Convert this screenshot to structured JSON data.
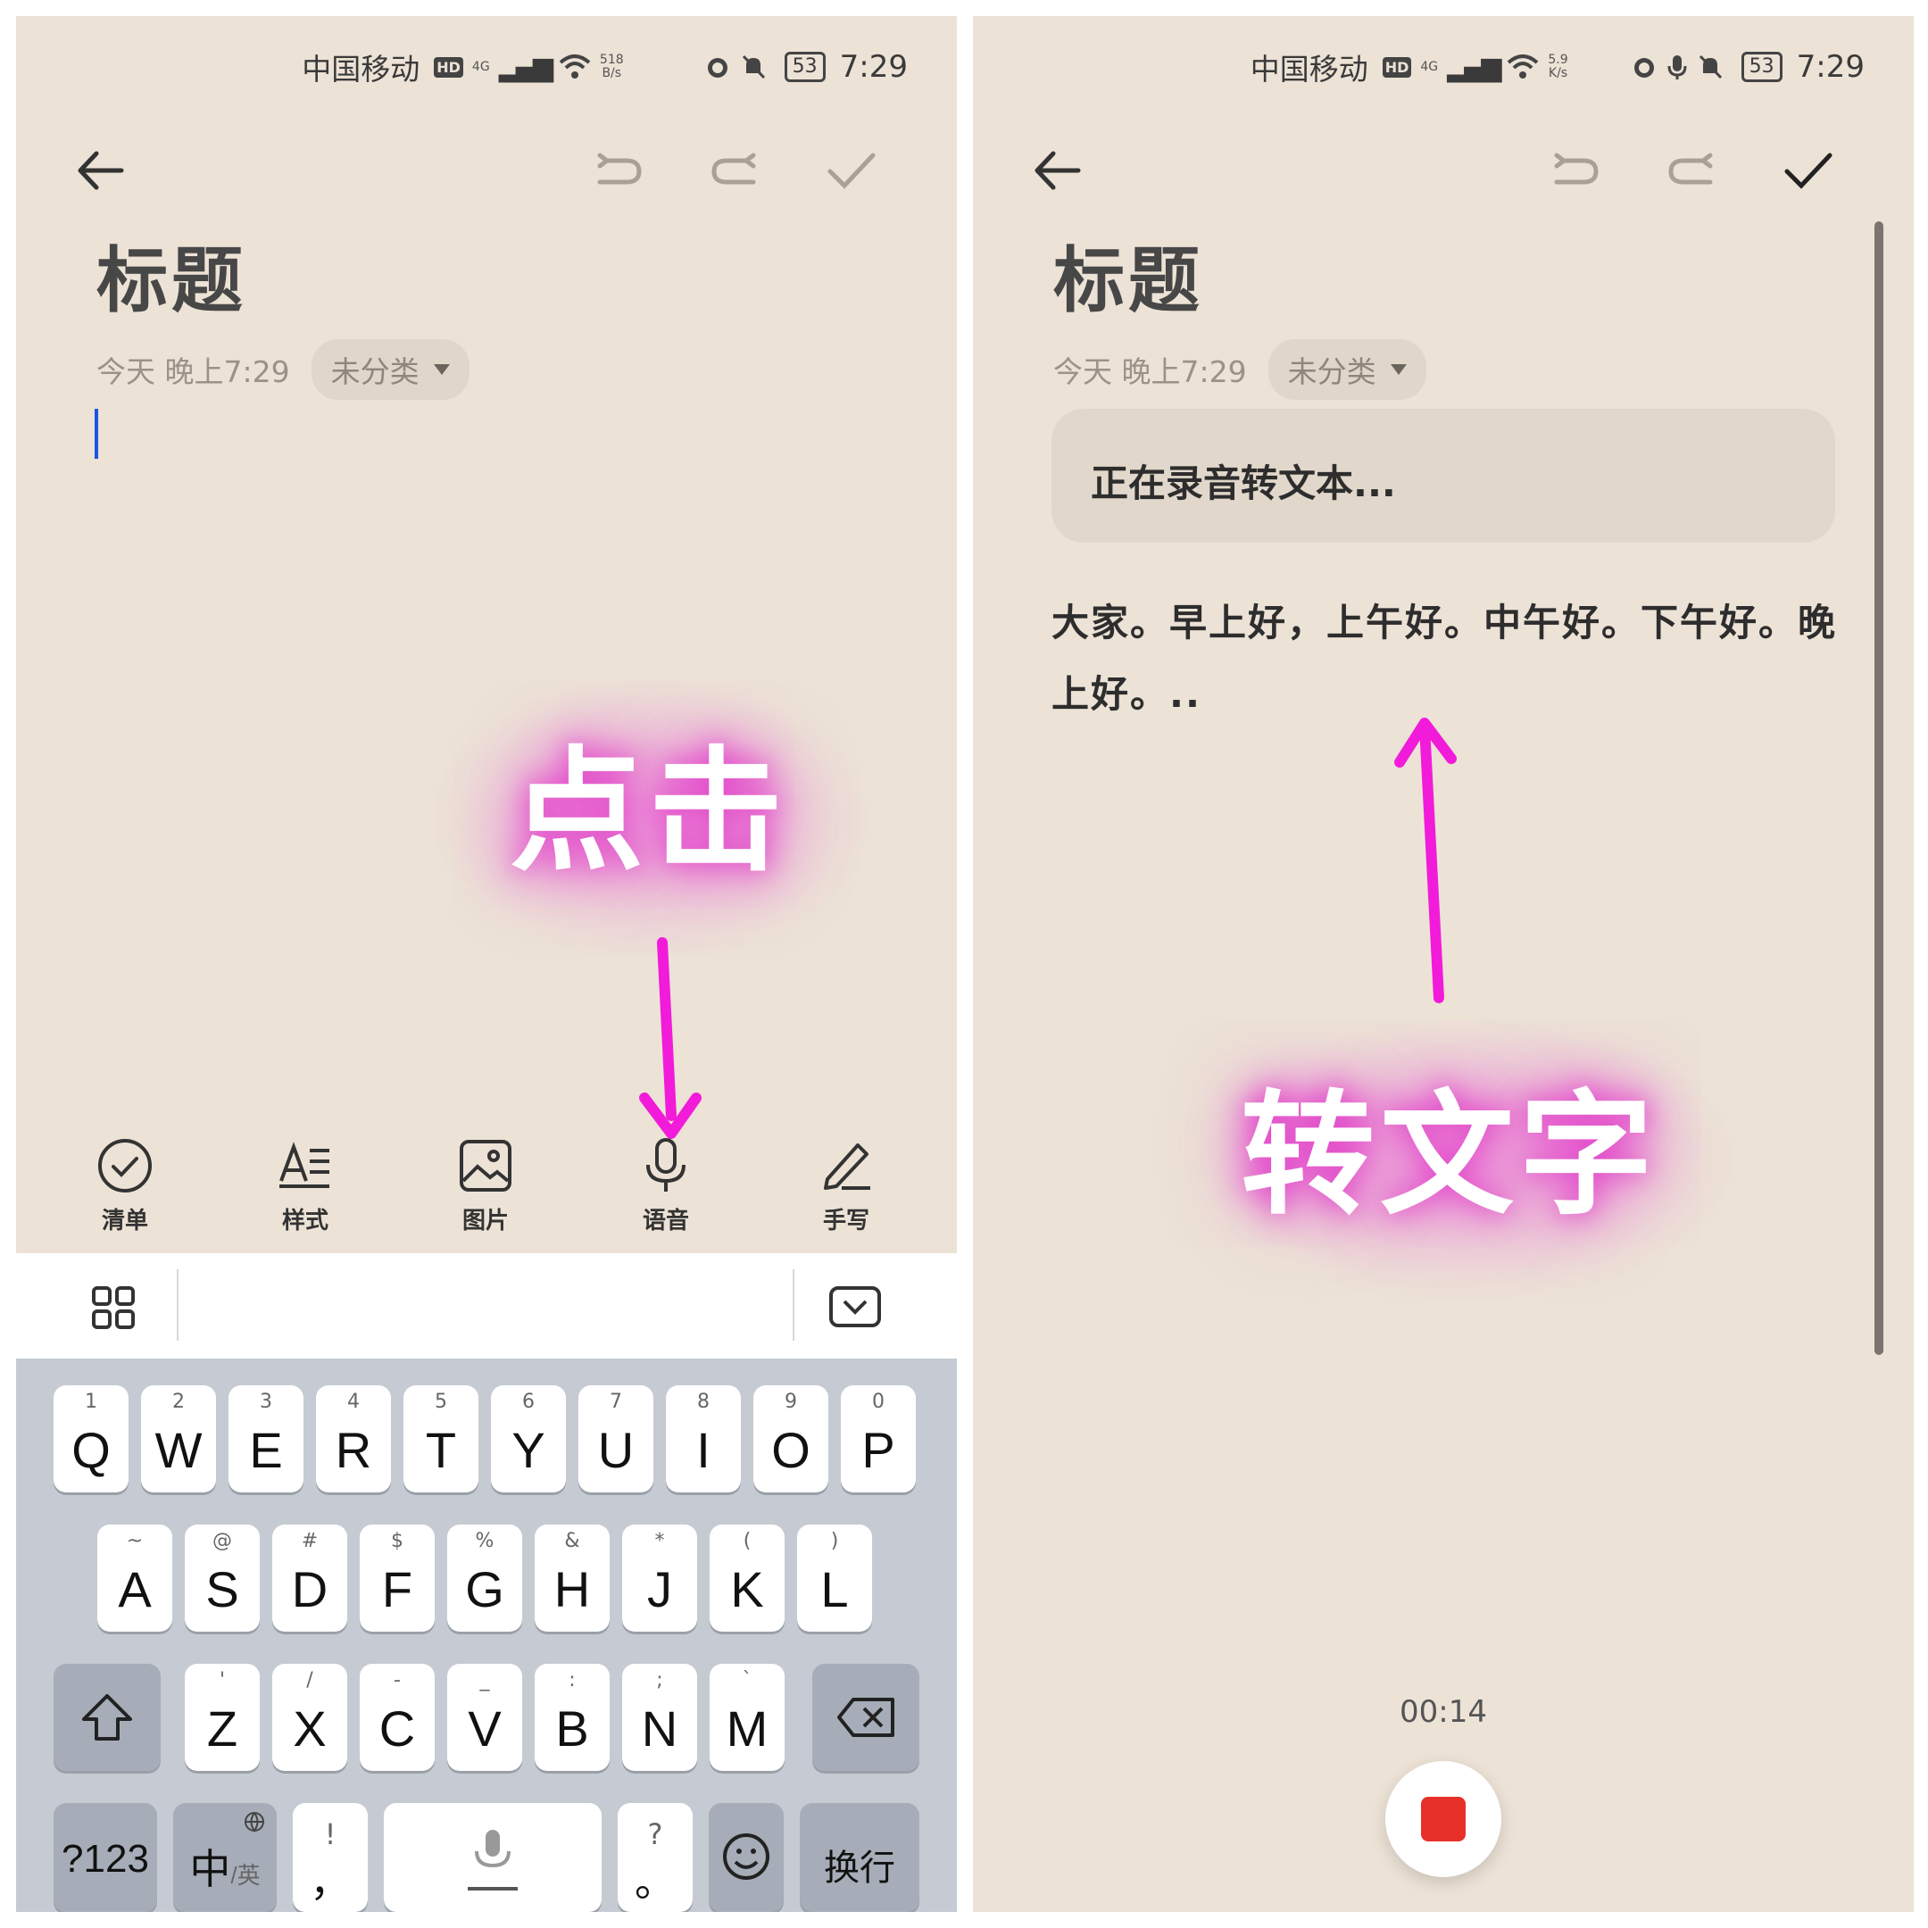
{
  "left": {
    "status": {
      "carrier": "中国移动",
      "hd": "HD",
      "net": "4G",
      "speed_top": "518",
      "speed_bottom": "B/s",
      "battery": "53",
      "time": "7:29"
    },
    "note": {
      "title": "标题",
      "date": "今天 晚上7:29",
      "category": "未分类"
    },
    "toolbar": [
      {
        "label": "清单",
        "icon": "checklist-icon"
      },
      {
        "label": "样式",
        "icon": "text-style-icon"
      },
      {
        "label": "图片",
        "icon": "image-icon"
      },
      {
        "label": "语音",
        "icon": "microphone-icon"
      },
      {
        "label": "手写",
        "icon": "handwriting-pen-icon"
      }
    ],
    "annotation": "点击",
    "keyboard": {
      "row1": [
        [
          "1",
          "Q"
        ],
        [
          "2",
          "W"
        ],
        [
          "3",
          "E"
        ],
        [
          "4",
          "R"
        ],
        [
          "5",
          "T"
        ],
        [
          "6",
          "Y"
        ],
        [
          "7",
          "U"
        ],
        [
          "8",
          "I"
        ],
        [
          "9",
          "O"
        ],
        [
          "0",
          "P"
        ]
      ],
      "row2": [
        [
          "~",
          "A"
        ],
        [
          "@",
          "S"
        ],
        [
          "#",
          "D"
        ],
        [
          "$",
          "F"
        ],
        [
          "%",
          "G"
        ],
        [
          "&",
          "H"
        ],
        [
          "*",
          "J"
        ],
        [
          "(",
          "K"
        ],
        [
          ")",
          "L"
        ]
      ],
      "row3": [
        [
          "'",
          "Z"
        ],
        [
          "/",
          "X"
        ],
        [
          "-",
          "C"
        ],
        [
          "_",
          "V"
        ],
        [
          ":",
          "B"
        ],
        [
          ";",
          "N"
        ],
        [
          "`",
          "M"
        ]
      ],
      "num_key": "?123",
      "lang_key": "中",
      "lang_sub": "/英",
      "comma_hint": "!",
      "comma": "，",
      "period_hint": "?",
      "period": "。",
      "enter_key": "换行"
    }
  },
  "right": {
    "status": {
      "carrier": "中国移动",
      "hd": "HD",
      "net": "4G",
      "speed_top": "5.9",
      "speed_bottom": "K/s",
      "battery": "53",
      "time": "7:29"
    },
    "note": {
      "title": "标题",
      "date": "今天 晚上7:29",
      "category": "未分类"
    },
    "recording_banner": "正在录音转文本...",
    "transcript": "大家。早上好，上午好。中午好。下午好。晚上好。..",
    "timer": "00:14",
    "annotation": "转文字"
  },
  "colors": {
    "paper": "#ece2d6",
    "accent": "#f21bd9",
    "stop": "#e8302a",
    "cursor": "#1a56e0"
  }
}
